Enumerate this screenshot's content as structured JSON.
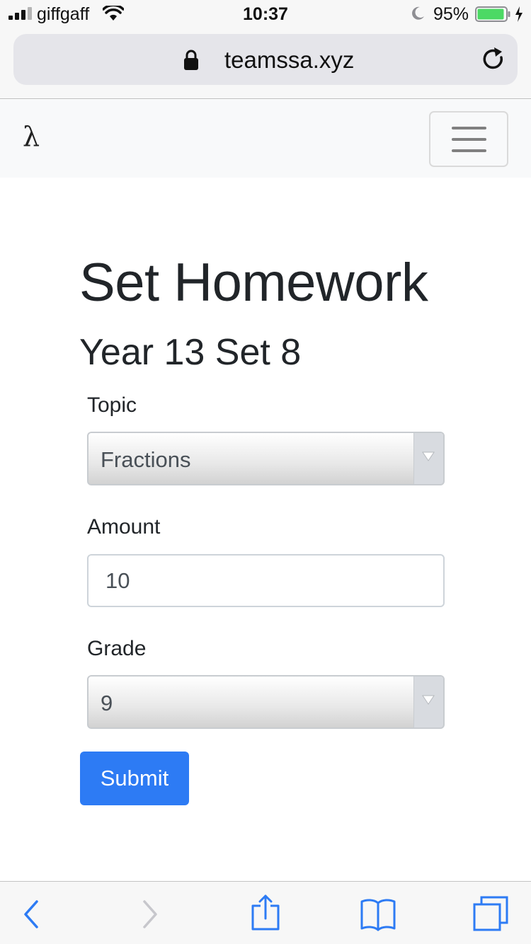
{
  "status_bar": {
    "carrier": "giffgaff",
    "time": "10:37",
    "battery_percent": "95%",
    "battery_level": 0.95,
    "icons": [
      "signal-icon",
      "wifi-icon",
      "moon-icon",
      "battery-icon",
      "charging-icon"
    ]
  },
  "browser": {
    "url": "teamssa.xyz",
    "icons": [
      "lock-icon",
      "reload-icon"
    ]
  },
  "navbar": {
    "brand": "λ",
    "toggle_icon": "hamburger-menu-icon"
  },
  "page": {
    "title": "Set Homework",
    "subtitle": "Year 13 Set 8"
  },
  "form": {
    "topic": {
      "label": "Topic",
      "value": "Fractions"
    },
    "amount": {
      "label": "Amount",
      "value": "10"
    },
    "grade": {
      "label": "Grade",
      "value": "9"
    },
    "submit_label": "Submit"
  },
  "toolbar": {
    "icons": [
      "back-icon",
      "forward-icon",
      "share-icon",
      "bookmarks-icon",
      "tabs-icon"
    ],
    "accent_color": "#2d7bf4",
    "disabled_color": "#c7c7cc"
  }
}
